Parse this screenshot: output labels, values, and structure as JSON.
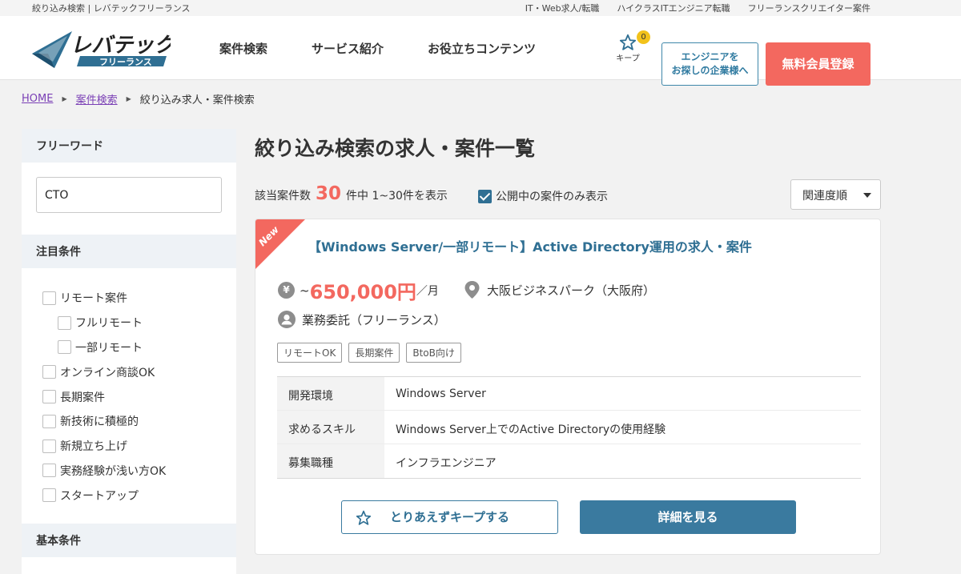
{
  "topbar": {
    "site_label": "絞り込み検索 | レバテックフリーランス",
    "links": [
      "IT・Web求人/転職",
      "ハイクラスITエンジニア転職",
      "フリーランスクリエイター案件"
    ]
  },
  "header": {
    "logo_main": "レバテック",
    "logo_sub": "フリーランス",
    "nav": [
      "案件検索",
      "サービス紹介",
      "お役立ちコンテンツ"
    ],
    "keep_label": "キープ",
    "keep_count": "0",
    "company_button_line1": "エンジニアを",
    "company_button_line2": "お探しの企業様へ",
    "register_button": "無料会員登録"
  },
  "breadcrumb": {
    "home": "HOME",
    "search": "案件検索",
    "current": "絞り込み求人・案件検索"
  },
  "sidebar": {
    "freeword_heading": "フリーワード",
    "freeword_value": "CTO",
    "featured_heading": "注目条件",
    "conditions": [
      {
        "label": "リモート案件",
        "sub": false
      },
      {
        "label": "フルリモート",
        "sub": true
      },
      {
        "label": "一部リモート",
        "sub": true
      },
      {
        "label": "オンライン商談OK",
        "sub": false
      },
      {
        "label": "長期案件",
        "sub": false
      },
      {
        "label": "新技術に積極的",
        "sub": false
      },
      {
        "label": "新規立ち上げ",
        "sub": false
      },
      {
        "label": "実務経験が浅い方OK",
        "sub": false
      },
      {
        "label": "スタートアップ",
        "sub": false
      }
    ],
    "basic_heading": "基本条件"
  },
  "main": {
    "title": "絞り込み検索の求人・案件一覧",
    "count_prefix": "該当案件数",
    "count": "30",
    "count_suffix": "件中 1~30件を表示",
    "public_only_label": "公開中の案件のみ表示",
    "sort_label": "関連度順"
  },
  "job": {
    "new_badge": "New",
    "title": "【Windows Server/一部リモート】Active Directory運用の求人・案件",
    "yen_icon": "¥",
    "price_prefix": "~",
    "price": "650,000円",
    "price_unit": "／月",
    "location": "大阪ビジネスパーク（大阪府）",
    "employment": "業務委託（フリーランス）",
    "tags": [
      "リモートOK",
      "長期案件",
      "BtoB向け"
    ],
    "specs": [
      {
        "key": "開発環境",
        "value": "Windows Server"
      },
      {
        "key": "求めるスキル",
        "value": "Windows Server上でのActive Directoryの使用経験"
      },
      {
        "key": "募集職種",
        "value": "インフラエンジニア"
      }
    ],
    "keep_button": "とりあえずキープする",
    "detail_button": "詳細を見る"
  },
  "colors": {
    "accent_red": "#f3685f",
    "primary_blue": "#3a7a9f",
    "badge_yellow": "#f2c21b"
  }
}
